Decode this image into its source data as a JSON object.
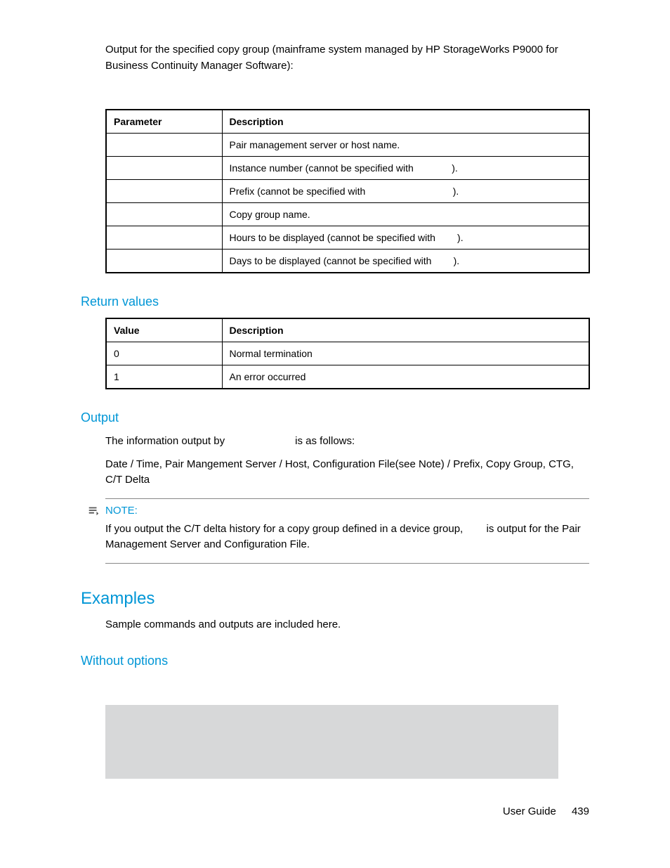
{
  "intro": "Output for the specified copy group (mainframe system managed by HP StorageWorks P9000 for Business Continuity Manager Software):",
  "table1": {
    "headers": {
      "col1": "Parameter",
      "col2": "Description"
    },
    "rows": [
      {
        "param": "",
        "desc_pre": "Pair management server or host name.",
        "desc_post": ""
      },
      {
        "param": "",
        "desc_pre": "Instance number (cannot be specified with",
        "desc_post": ")."
      },
      {
        "param": "",
        "desc_pre": "Prefix (cannot be specified with",
        "desc_post": ")."
      },
      {
        "param": "",
        "desc_pre": "Copy group name.",
        "desc_post": ""
      },
      {
        "param": "",
        "desc_pre": "Hours to be displayed (cannot be specified with",
        "desc_post": ")."
      },
      {
        "param": "",
        "desc_pre": "Days to be displayed (cannot be specified with",
        "desc_post": ")."
      }
    ]
  },
  "return_values_heading": "Return values",
  "table2": {
    "headers": {
      "col1": "Value",
      "col2": "Description"
    },
    "rows": [
      {
        "val": "0",
        "desc": "Normal termination"
      },
      {
        "val": "1",
        "desc": "An error occurred"
      }
    ]
  },
  "output_heading": "Output",
  "output_p1_a": "The information output by",
  "output_p1_b": "is as follows:",
  "output_p2": "Date / Time, Pair Mangement Server / Host, Configuration File(see Note) / Prefix, Copy Group, CTG, C/T Delta",
  "note_label": "NOTE:",
  "note_text_a": "If you output the C/T delta history for a copy group defined in a device group,",
  "note_text_b": "is output for the Pair Management Server and Configuration File.",
  "examples_heading": "Examples",
  "examples_intro": "Sample commands and outputs are included here.",
  "without_options_heading": "Without options",
  "footer_label": "User Guide",
  "footer_page": "439"
}
